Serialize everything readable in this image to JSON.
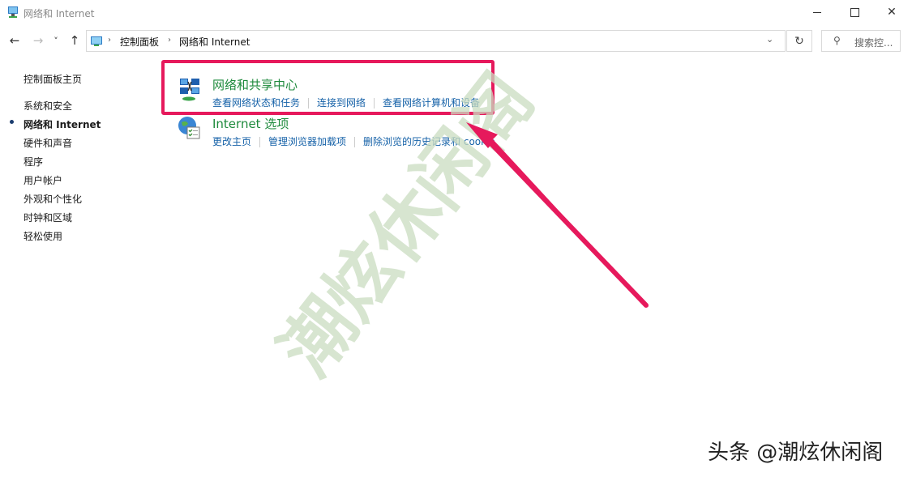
{
  "window": {
    "title": "网络和 Internet"
  },
  "nav": {
    "back_icon": "←",
    "forward_icon": "→",
    "dropdown_icon": "˅",
    "up_icon": "↑",
    "breadcrumb": [
      "控制面板",
      "网络和 Internet"
    ],
    "address_dropdown_icon": "⌄",
    "refresh_icon": "↻",
    "search_placeholder": "搜索控..."
  },
  "sidebar": {
    "items": [
      "控制面板主页",
      "系统和安全",
      "网络和 Internet",
      "硬件和声音",
      "程序",
      "用户帐户",
      "外观和个性化",
      "时钟和区域",
      "轻松使用"
    ],
    "current": "网络和 Internet"
  },
  "categories": [
    {
      "title": "网络和共享中心",
      "icon": "network-sharing-icon",
      "links": [
        "查看网络状态和任务",
        "连接到网络",
        "查看网络计算机和设备"
      ]
    },
    {
      "title": "Internet 选项",
      "icon": "internet-options-icon",
      "links": [
        "更改主页",
        "管理浏览器加载项",
        "删除浏览的历史记录和 cookie"
      ]
    }
  ],
  "annotation": {
    "highlight_color": "#e6195c",
    "watermark_text": "潮炫休闲阁",
    "credit_text": "头条 @潮炫休闲阁"
  },
  "colors": {
    "category_title": "#1e8a3c",
    "link": "#1662a8"
  }
}
